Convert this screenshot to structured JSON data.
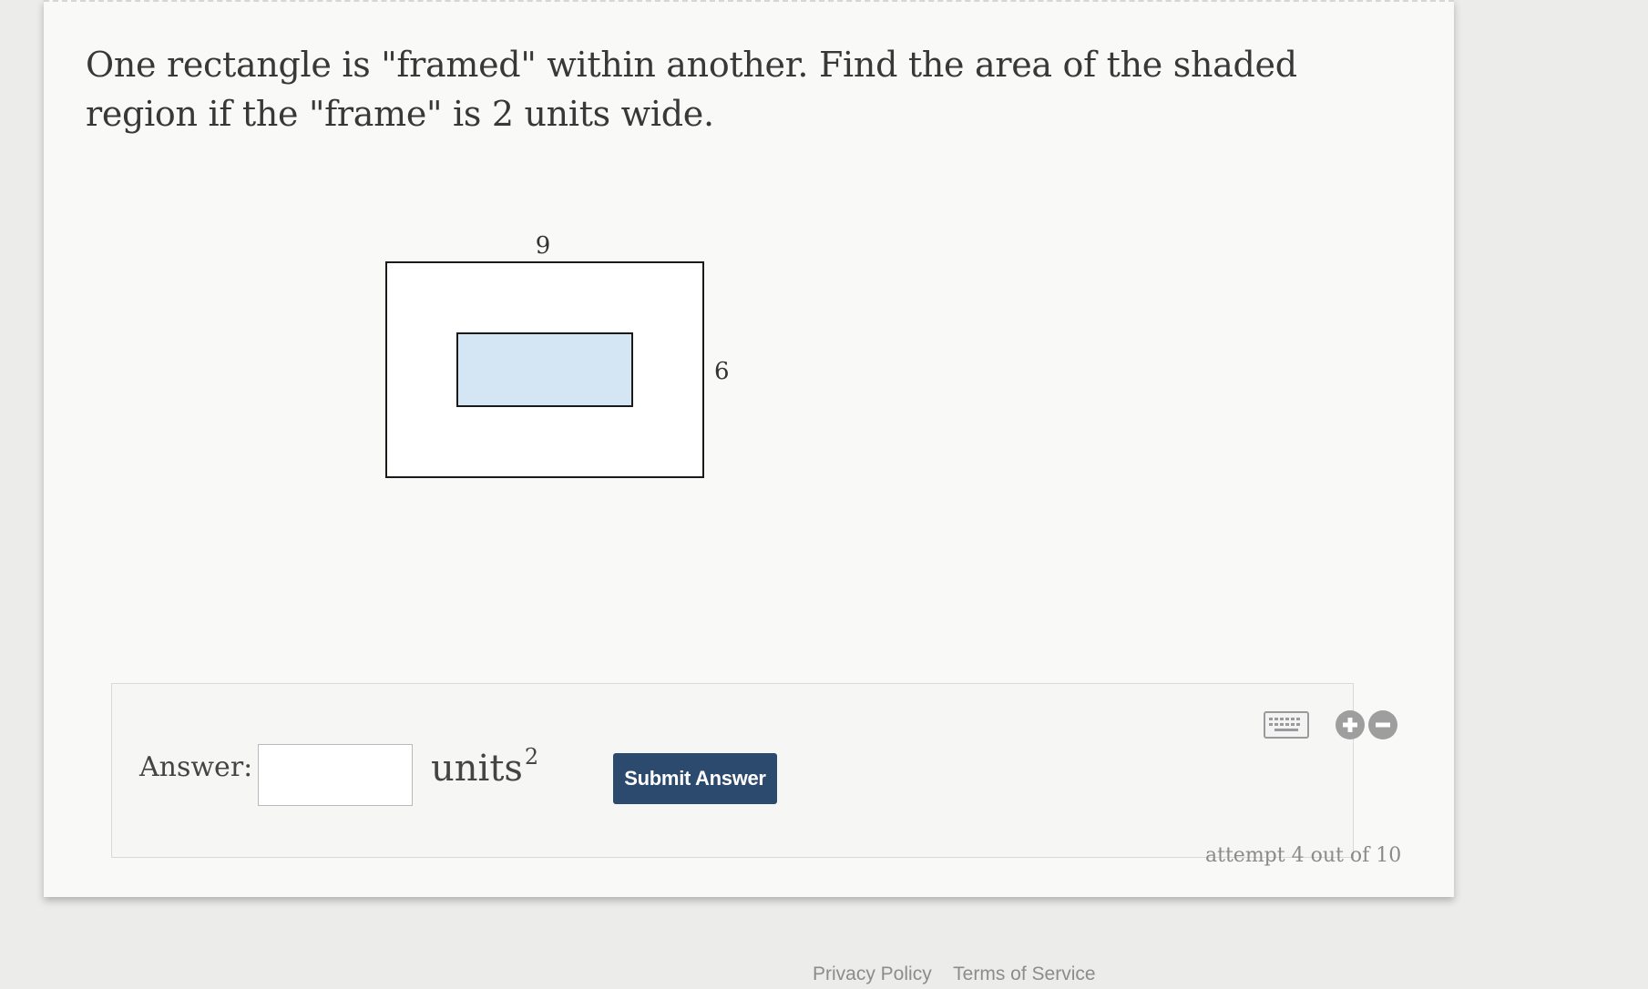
{
  "question": {
    "text": "One rectangle is \"framed\" within another. Find the area of the shaded region if the \"frame\" is 2 units wide."
  },
  "figure": {
    "width_label": "9",
    "height_label": "6",
    "outer_width": 9,
    "outer_height": 6,
    "frame_width": 2,
    "shade_color": "#d4e6f4",
    "stroke_color": "#1a1a1a"
  },
  "answer": {
    "label": "Answer:",
    "value": "",
    "placeholder": "",
    "units": "units",
    "units_exponent": "2",
    "submit_label": "Submit Answer"
  },
  "tools": {
    "keyboard_icon": "keyboard-icon",
    "zoom_in_icon": "plus-circle-icon",
    "zoom_out_icon": "minus-circle-icon"
  },
  "status": {
    "attempt_text": "attempt 4 out of 10"
  },
  "footer": {
    "privacy": "Privacy Policy",
    "terms": "Terms of Service"
  },
  "colors": {
    "submit_bg": "#2c4a6e",
    "card_bg": "#f9f9f8",
    "page_bg": "#ececea"
  }
}
